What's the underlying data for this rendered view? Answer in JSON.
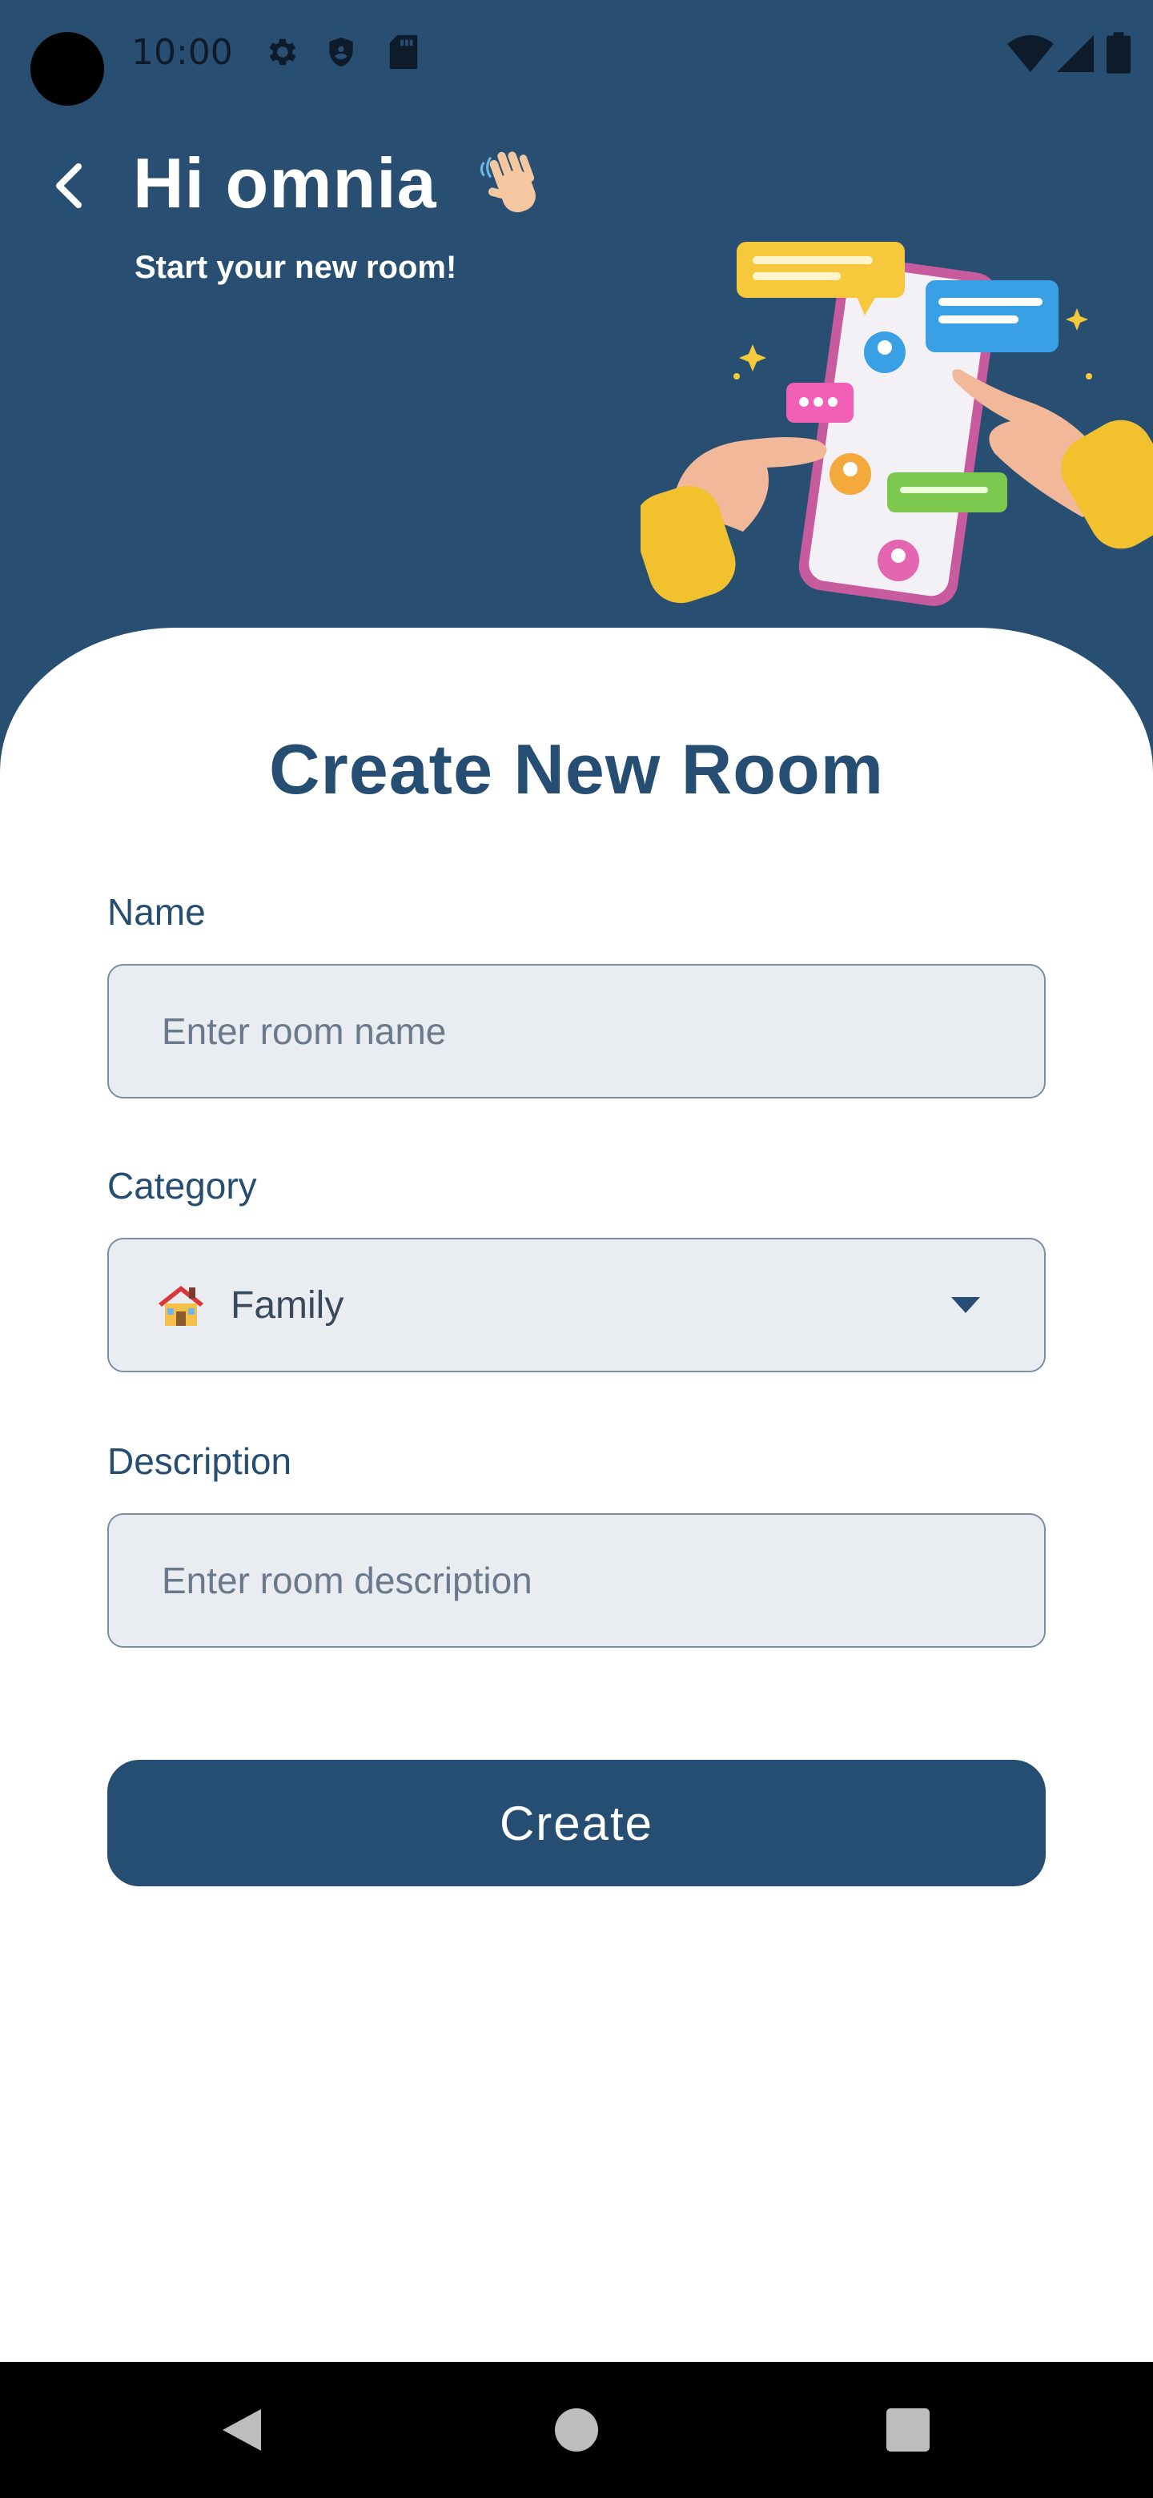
{
  "status_bar": {
    "time": "10:00",
    "icons": [
      "gear-icon",
      "shield-icon",
      "sd-card-icon",
      "wifi-icon",
      "signal-icon",
      "battery-icon"
    ]
  },
  "header": {
    "greeting": "Hi omnia",
    "wave_emoji": "👋",
    "subtitle": "Start your new room!",
    "background_color": "#284f72"
  },
  "form": {
    "title": "Create New Room",
    "name": {
      "label": "Name",
      "placeholder": "Enter room name",
      "value": ""
    },
    "category": {
      "label": "Category",
      "emoji": "🏠",
      "selected": "Family"
    },
    "description": {
      "label": "Description",
      "placeholder": "Enter room description",
      "value": ""
    },
    "submit_label": "Create"
  },
  "colors": {
    "primary": "#264e72",
    "field_bg": "#e9ecf1",
    "field_border": "#7b8ea4"
  }
}
